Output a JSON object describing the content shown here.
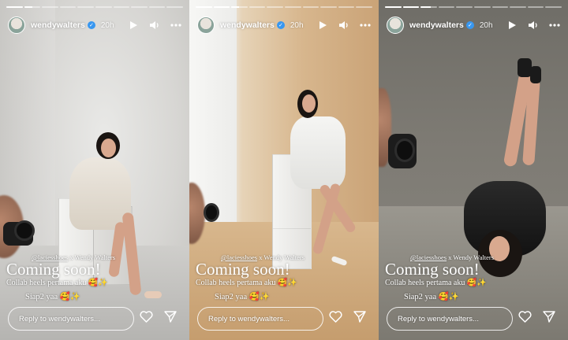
{
  "stories": [
    {
      "progress": [
        1,
        0.5,
        0,
        0,
        0,
        0,
        0,
        0,
        0,
        0
      ],
      "username": "wendywalters",
      "time": "20h",
      "mention_handle": "@laciesshoes",
      "mention_rest": " x Wendy Walters",
      "headline": "Coming soon!",
      "line1": "Collab heels pertama aku 🥰✨",
      "line2": "Siap2 yaa 🥰✨",
      "reply_placeholder": "Reply to wendywalters..."
    },
    {
      "progress": [
        1,
        1,
        0.5,
        0,
        0,
        0,
        0,
        0,
        0,
        0
      ],
      "username": "wendywalters",
      "time": "20h",
      "mention_handle": "@laciesshoes",
      "mention_rest": " x Wendy Walters",
      "headline": "Coming soon!",
      "line1": "Collab heels pertama aku 🥰✨",
      "line2": "Siap2 yaa 🥰✨",
      "reply_placeholder": "Reply to wendywalters..."
    },
    {
      "progress": [
        1,
        1,
        0.6,
        0,
        0,
        0,
        0,
        0,
        0,
        0
      ],
      "username": "wendywalters",
      "time": "20h",
      "mention_handle": "@laciesshoes",
      "mention_rest": " x Wendy Walters",
      "headline": "Coming soon!",
      "line1": "Collab heels pertama aku 🥰✨",
      "line2": "Siap2 yaa 🥰✨",
      "reply_placeholder": "Reply to wendywalters..."
    }
  ],
  "icons": {
    "play": "play-icon",
    "sound": "volume-icon",
    "more": "more-icon",
    "like": "heart-icon",
    "share": "send-icon",
    "verified": "verified-badge-icon"
  },
  "colors": {
    "verified": "#3897f0",
    "text": "#ffffff"
  }
}
